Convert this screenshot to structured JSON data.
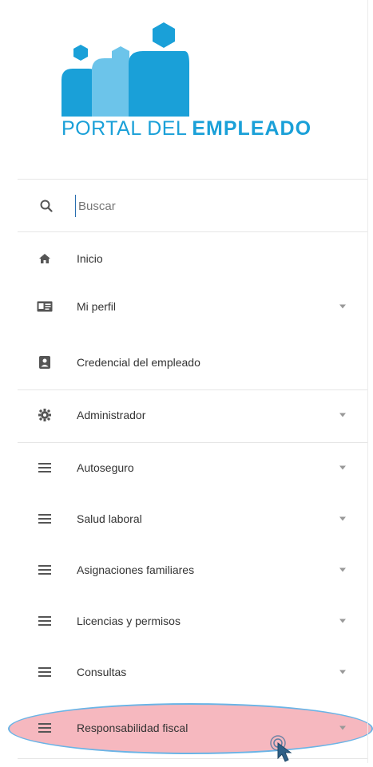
{
  "logo": {
    "text_light": "PORTAL DEL",
    "text_bold": "EMPLEADO",
    "color": "#1aa0d8"
  },
  "search": {
    "placeholder": "Buscar",
    "value": "",
    "icon": "search-icon"
  },
  "menu": {
    "items": [
      {
        "label": "Inicio",
        "icon": "home-icon",
        "has_dropdown": false
      },
      {
        "label": "Mi perfil",
        "icon": "id-card-icon",
        "has_dropdown": true
      },
      {
        "label": "Credencial del empleado",
        "icon": "badge-icon",
        "has_dropdown": false
      },
      {
        "label": "Administrador",
        "icon": "gear-icon",
        "has_dropdown": true
      },
      {
        "label": "Autoseguro",
        "icon": "list-icon",
        "has_dropdown": true
      },
      {
        "label": "Salud laboral",
        "icon": "list-icon",
        "has_dropdown": true
      },
      {
        "label": "Asignaciones familiares",
        "icon": "list-icon",
        "has_dropdown": true
      },
      {
        "label": "Licencias y permisos",
        "icon": "list-icon",
        "has_dropdown": true
      },
      {
        "label": "Consultas",
        "icon": "list-icon",
        "has_dropdown": true
      },
      {
        "label": "Responsabilidad fiscal",
        "icon": "list-icon",
        "has_dropdown": true,
        "highlighted": true
      }
    ]
  },
  "colors": {
    "accent": "#1aa0d8",
    "highlight": "#f3a0aa",
    "highlight_border": "#6ab4e6"
  }
}
